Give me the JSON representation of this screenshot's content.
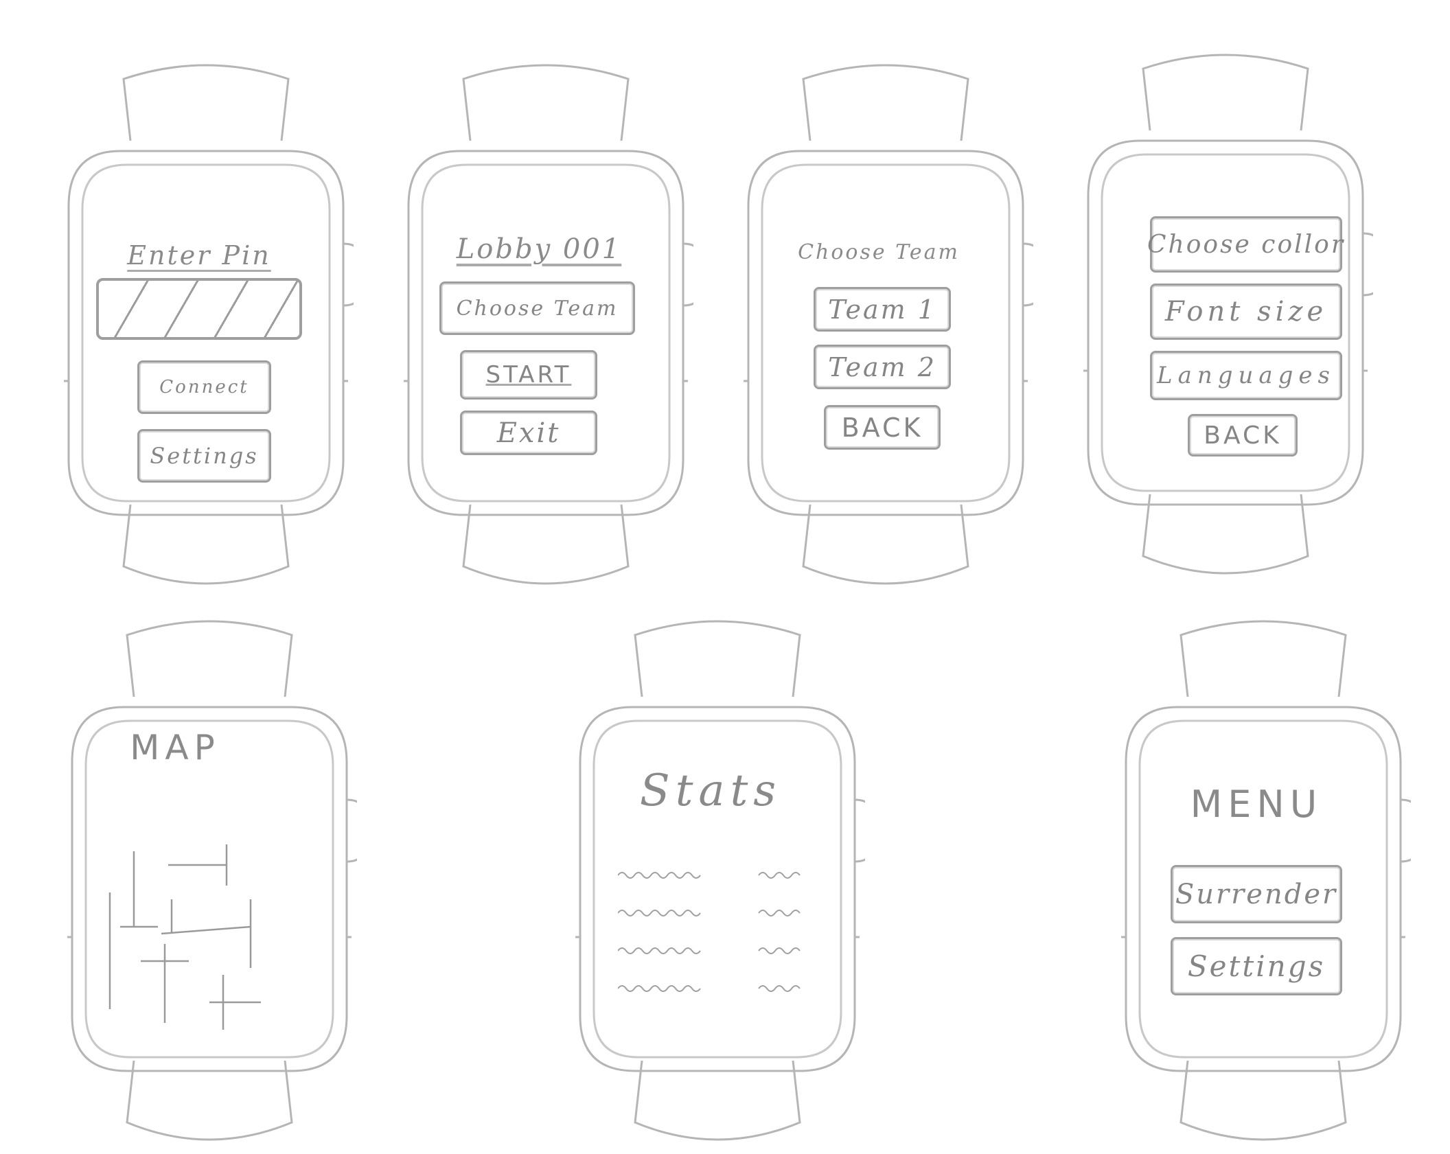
{
  "screens": {
    "enter_pin": {
      "title": "Enter Pin",
      "connect": "Connect",
      "settings": "Settings"
    },
    "lobby": {
      "title": "Lobby 001",
      "choose_team": "Choose Team",
      "start": "START",
      "exit": "Exit"
    },
    "choose_team": {
      "title": "Choose Team",
      "team1": "Team 1",
      "team2": "Team 2",
      "back": "BACK"
    },
    "settings": {
      "choose_color": "Choose collor",
      "font_size": "Font size",
      "languages": "Languages",
      "back": "BACK"
    },
    "map": {
      "title": "MAP"
    },
    "stats": {
      "title": "Stats"
    },
    "menu": {
      "title": "MENU",
      "surrender": "Surrender",
      "settings": "Settings"
    }
  },
  "colors": {
    "pencil": "#9e9e9e",
    "pencil_light": "#d0d0d0",
    "paper": "#ffffff"
  }
}
